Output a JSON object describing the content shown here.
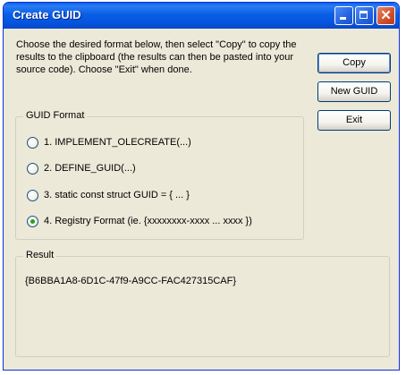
{
  "window": {
    "title": "Create GUID"
  },
  "title_buttons": {
    "minimize": "minimize-icon",
    "maximize": "maximize-icon",
    "close": "close-icon",
    "close_glyph": "✕"
  },
  "instructions": "Choose the desired format below, then select \"Copy\" to copy the results to the clipboard (the results can then be pasted into your source code).  Choose \"Exit\" when done.",
  "buttons": {
    "copy": "Copy",
    "new_guid": "New GUID",
    "exit": "Exit"
  },
  "guid_format": {
    "label": "GUID Format",
    "options": [
      {
        "label": "1. IMPLEMENT_OLECREATE(...)",
        "checked": false
      },
      {
        "label": "2. DEFINE_GUID(...)",
        "checked": false
      },
      {
        "label": "3. static const struct GUID = { ... }",
        "checked": false
      },
      {
        "label": "4. Registry Format (ie. {xxxxxxxx-xxxx ... xxxx })",
        "checked": true
      }
    ]
  },
  "result": {
    "label": "Result",
    "value": "{B6BBA1A8-6D1C-47f9-A9CC-FAC427315CAF}"
  },
  "colors": {
    "titlebar": "#0553dc",
    "dialog_bg": "#ece9d8",
    "radio_check": "#21a121"
  }
}
